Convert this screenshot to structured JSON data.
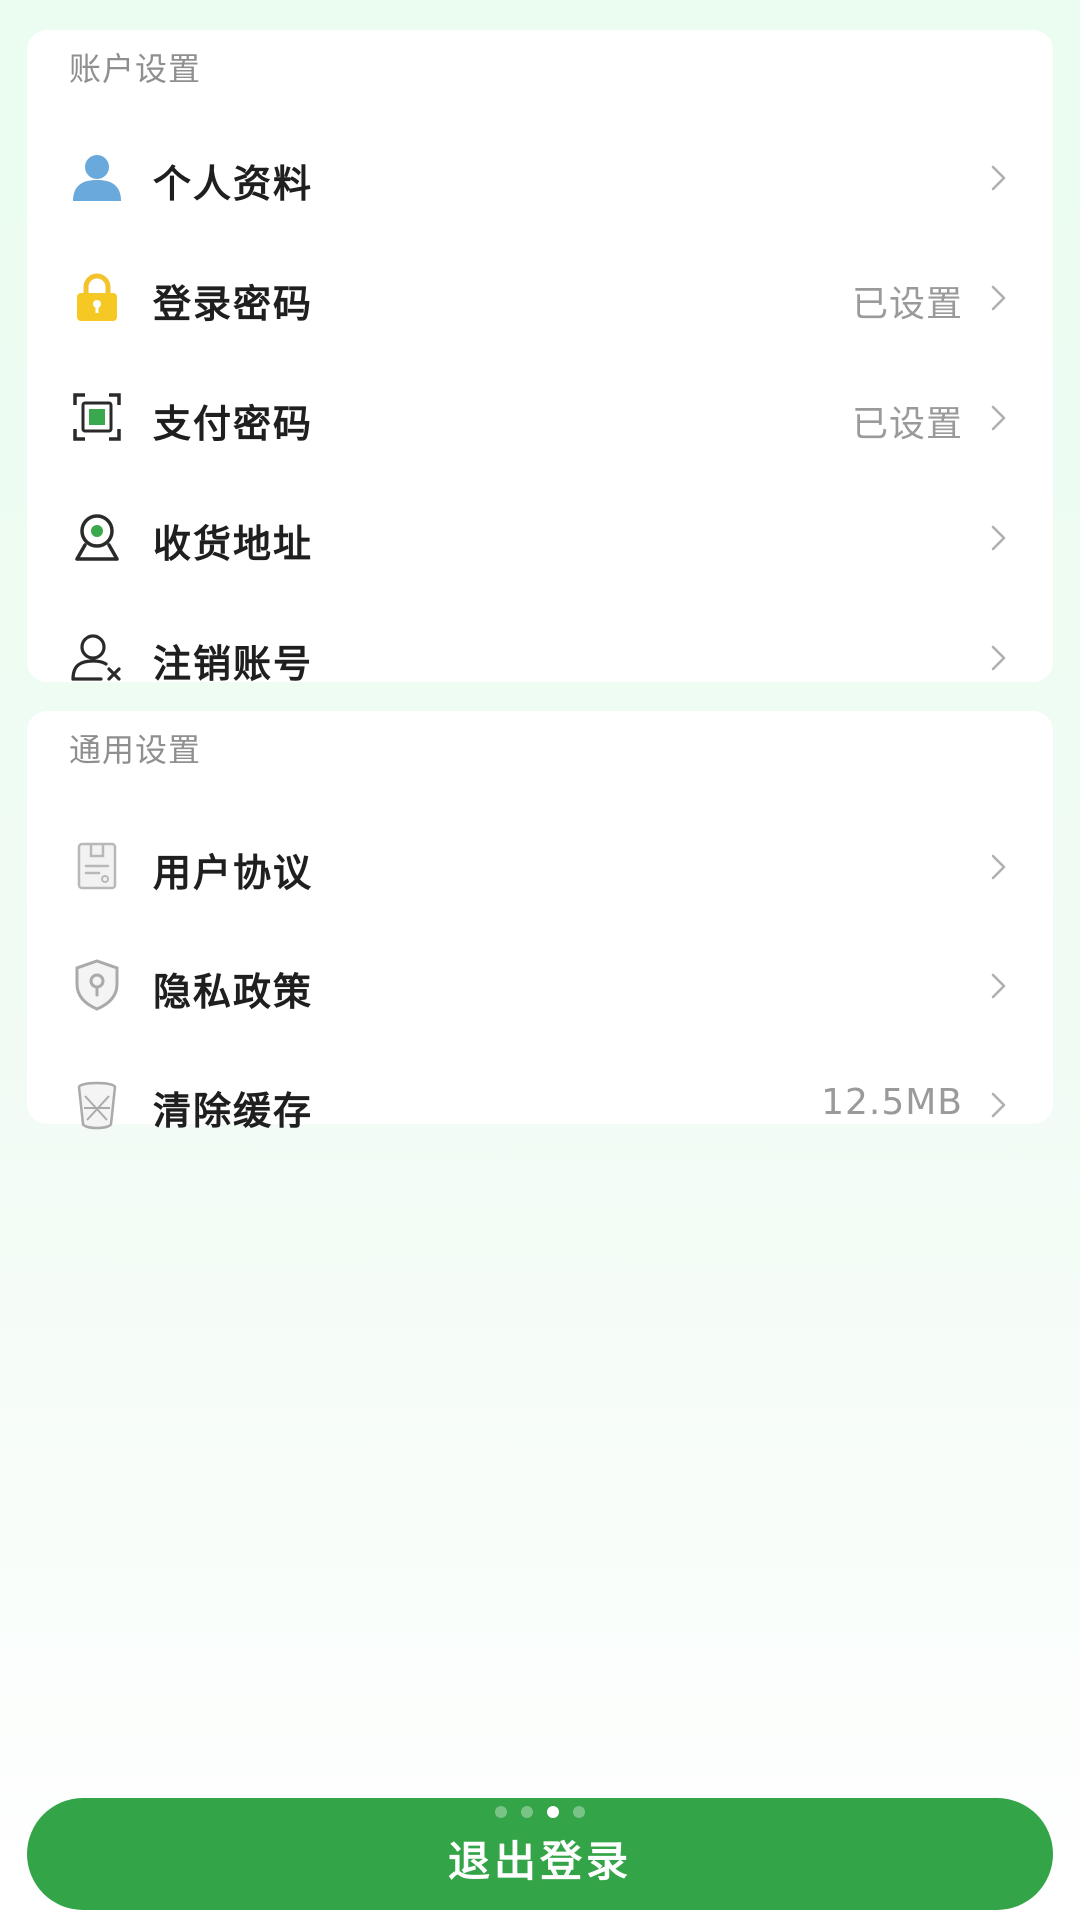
{
  "colors": {
    "accent": "#33a447",
    "label": "#1f1f1f",
    "secondary_text": "#9a9a9a",
    "section_title": "#8f8f8f"
  },
  "account_settings": {
    "title": "账户设置",
    "items": [
      {
        "label": "个人资料",
        "value": "",
        "icon": "user-profile-icon"
      },
      {
        "label": "登录密码",
        "value": "已设置",
        "icon": "lock-icon"
      },
      {
        "label": "支付密码",
        "value": "已设置",
        "icon": "scan-frame-icon"
      },
      {
        "label": "收货地址",
        "value": "",
        "icon": "location-pin-icon"
      },
      {
        "label": "注销账号",
        "value": "",
        "icon": "user-remove-icon"
      }
    ]
  },
  "general_settings": {
    "title": "通用设置",
    "items": [
      {
        "label": "用户协议",
        "value": "",
        "icon": "document-icon"
      },
      {
        "label": "隐私政策",
        "value": "",
        "icon": "shield-icon"
      },
      {
        "label": "清除缓存",
        "value": "12.5MB",
        "icon": "trash-icon"
      }
    ]
  },
  "logout": {
    "label": "退出登录"
  },
  "page_indicator": {
    "count": 4,
    "active_index": 2
  }
}
